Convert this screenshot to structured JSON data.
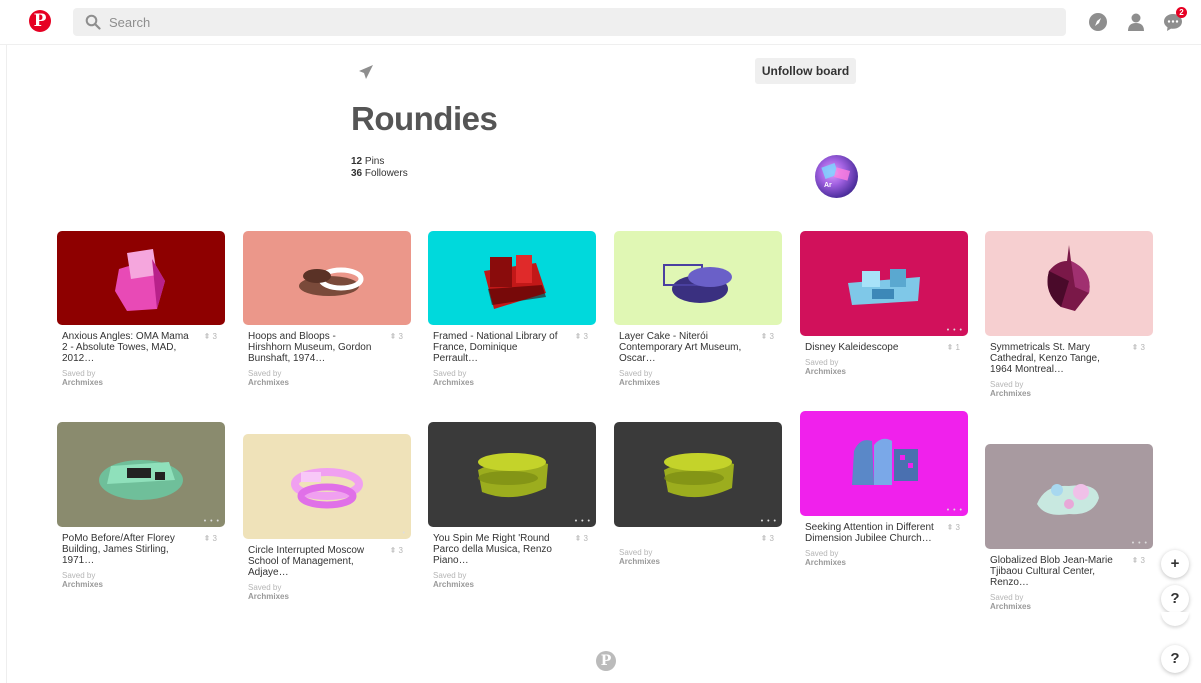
{
  "header": {
    "logo_icon": "pinterest-logo",
    "search_placeholder": "Search",
    "notification_count": "2"
  },
  "board": {
    "unfollow_label": "Unfollow board",
    "title": "Roundies",
    "pins_count": "12",
    "pins_label": " Pins",
    "followers_count": "36",
    "followers_label": " Followers",
    "avatar_text": "Ar"
  },
  "pins": [
    {
      "desc": "Anxious Angles: OMA Mama 2 - Absolute Towes, MAD, 2012…",
      "repins": "3",
      "saved_by": "Saved by",
      "owner": "Archmixes",
      "bg": "#8e0000"
    },
    {
      "desc": "Hoops and Bloops - Hirshhorn Museum, Gordon Bunshaft, 1974…",
      "repins": "3",
      "saved_by": "Saved by",
      "owner": "Archmixes",
      "bg": "#eb978a"
    },
    {
      "desc": "Framed - National Library of France, Dominique Perrault…",
      "repins": "3",
      "saved_by": "Saved by",
      "owner": "Archmixes",
      "bg": "#00d9dc"
    },
    {
      "desc": "Layer Cake - Niterói Contemporary Art Museum, Oscar…",
      "repins": "3",
      "saved_by": "Saved by",
      "owner": "Archmixes",
      "bg": "#e0f7b4"
    },
    {
      "desc": "Disney Kaleidescope",
      "repins": "1",
      "saved_by": "Saved by",
      "owner": "Archmixes",
      "bg": "#d1115b"
    },
    {
      "desc": "Symmetricals St. Mary Cathedral, Kenzo Tange, 1964 Montreal…",
      "repins": "3",
      "saved_by": "Saved by",
      "owner": "Archmixes",
      "bg": "#f6cfd0"
    },
    {
      "desc": "PoMo Before/After Florey Building, James Stirling, 1971…",
      "repins": "3",
      "saved_by": "Saved by",
      "owner": "Archmixes",
      "bg": "#8a8b6e"
    },
    {
      "desc": "Circle Interrupted Moscow School of Management, Adjaye…",
      "repins": "3",
      "saved_by": "Saved by",
      "owner": "Archmixes",
      "bg": "#efe2b9"
    },
    {
      "desc": "You Spin Me Right 'Round Parco della Musica, Renzo Piano…",
      "repins": "3",
      "saved_by": "Saved by",
      "owner": "Archmixes",
      "bg": "#3a3a3a"
    },
    {
      "desc": "",
      "repins": "3",
      "saved_by": "Saved by",
      "owner": "Archmixes",
      "bg": "#3a3a3a"
    },
    {
      "desc": "Seeking Attention in Different Dimension Jubilee Church…",
      "repins": "3",
      "saved_by": "Saved by",
      "owner": "Archmixes",
      "bg": "#f021ec"
    },
    {
      "desc": "Globalized Blob Jean-Marie Tjibaou Cultural Center, Renzo…",
      "repins": "3",
      "saved_by": "Saved by",
      "owner": "Archmixes",
      "bg": "#a89aa0"
    }
  ],
  "fabs": {
    "add_label": "+",
    "help_label": "?",
    "help2_label": "?"
  },
  "colors": {
    "brand": "#e60023",
    "button_bg": "#efefef",
    "muted_text": "#b5b5b5"
  }
}
